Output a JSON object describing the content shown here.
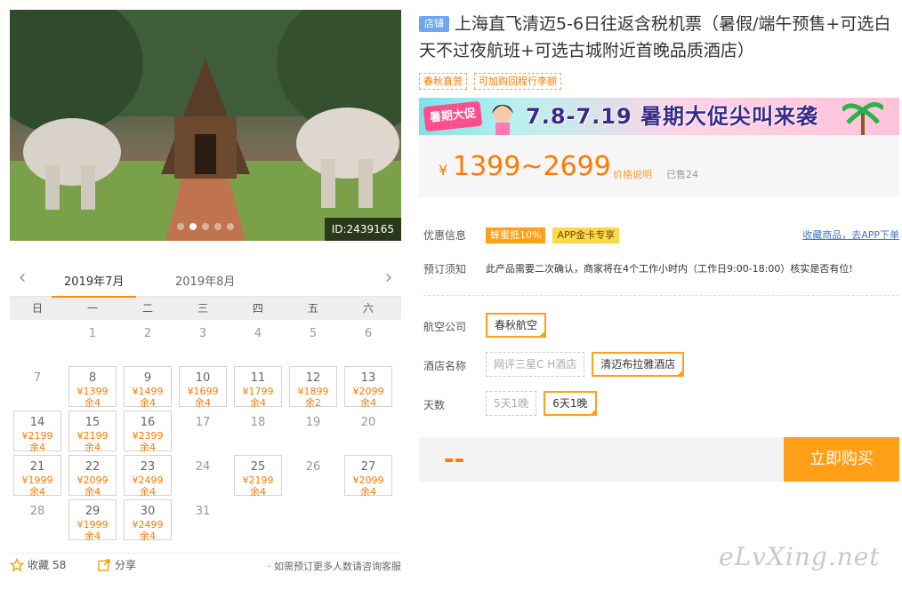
{
  "photo": {
    "id_label": "ID:2439165",
    "slide_count": 5,
    "active_slide": 1
  },
  "calendar": {
    "tabs": [
      "2019年7月",
      "2019年8月"
    ],
    "weekdays": [
      "日",
      "一",
      "二",
      "三",
      "四",
      "五",
      "六"
    ],
    "weeks": [
      [
        {
          "d": ""
        },
        {
          "d": "1"
        },
        {
          "d": "2"
        },
        {
          "d": "3"
        },
        {
          "d": "4"
        },
        {
          "d": "5"
        },
        {
          "d": "6"
        }
      ],
      [
        {
          "d": "7"
        },
        {
          "d": "8",
          "p": "¥1399",
          "s": "余4"
        },
        {
          "d": "9",
          "p": "¥1499",
          "s": "余4"
        },
        {
          "d": "10",
          "p": "¥1699",
          "s": "余4"
        },
        {
          "d": "11",
          "p": "¥1799",
          "s": "余4"
        },
        {
          "d": "12",
          "p": "¥1899",
          "s": "余2"
        },
        {
          "d": "13",
          "p": "¥2099",
          "s": "余4"
        }
      ],
      [
        {
          "d": "14",
          "p": "¥2199",
          "s": "余4"
        },
        {
          "d": "15",
          "p": "¥2199",
          "s": "余4"
        },
        {
          "d": "16",
          "p": "¥2399",
          "s": "余4"
        },
        {
          "d": "17"
        },
        {
          "d": "18"
        },
        {
          "d": "19"
        },
        {
          "d": "20"
        }
      ],
      [
        {
          "d": "21",
          "p": "¥1999",
          "s": "余4"
        },
        {
          "d": "22",
          "p": "¥2099",
          "s": "余4"
        },
        {
          "d": "23",
          "p": "¥2499",
          "s": "余4"
        },
        {
          "d": "24"
        },
        {
          "d": "25",
          "p": "¥2199",
          "s": "余4"
        },
        {
          "d": "26"
        },
        {
          "d": "27",
          "p": "¥2099",
          "s": "余4"
        }
      ],
      [
        {
          "d": "28"
        },
        {
          "d": "29",
          "p": "¥1999",
          "s": "余4"
        },
        {
          "d": "30",
          "p": "¥2499",
          "s": "余4"
        },
        {
          "d": "31"
        },
        {
          "d": ""
        },
        {
          "d": ""
        },
        {
          "d": ""
        }
      ]
    ]
  },
  "bottom": {
    "fav_label": "收藏",
    "fav_count": "58",
    "share_label": "分享",
    "note": "· 如需预订更多人数请咨询客服"
  },
  "product": {
    "shop_tag": "店铺",
    "title": "上海直飞清迈5-6日往返含税机票（暑假/端午预售+可选白天不过夜航班+可选古城附近首晚品质酒店）",
    "tags": [
      "春秋直营",
      "可加购回程行李额"
    ]
  },
  "banner": {
    "badge": "暑期大促",
    "text": "7.8-7.19 暑期大促尖叫来袭"
  },
  "price": {
    "currency": "¥",
    "range": "1399~2699",
    "explain": "价格说明",
    "sold": "已售24"
  },
  "promo": {
    "label": "优惠信息",
    "badge1": "蜂蜜抵10%",
    "badge2": "APP金卡专享",
    "app_link": "收藏商品，去APP下单"
  },
  "notice": {
    "label": "预订须知",
    "text": "此产品需要二次确认，商家将在4个工作小时内（工作日9:00-18:00）核实是否有位!"
  },
  "airline": {
    "label": "航空公司",
    "options": [
      {
        "name": "春秋航空",
        "state": "sel"
      }
    ]
  },
  "hotel": {
    "label": "酒店名称",
    "options": [
      {
        "name": "网评三星C H酒店",
        "state": "dis"
      },
      {
        "name": "清迈布拉雅酒店",
        "state": "sel"
      }
    ]
  },
  "days": {
    "label": "天数",
    "options": [
      {
        "name": "5天1晚",
        "state": "dis"
      },
      {
        "name": "6天1晚",
        "state": "sel"
      }
    ]
  },
  "buy": {
    "price_placeholder": "--",
    "button": "立即购买"
  },
  "watermark": "eLvXing.net"
}
